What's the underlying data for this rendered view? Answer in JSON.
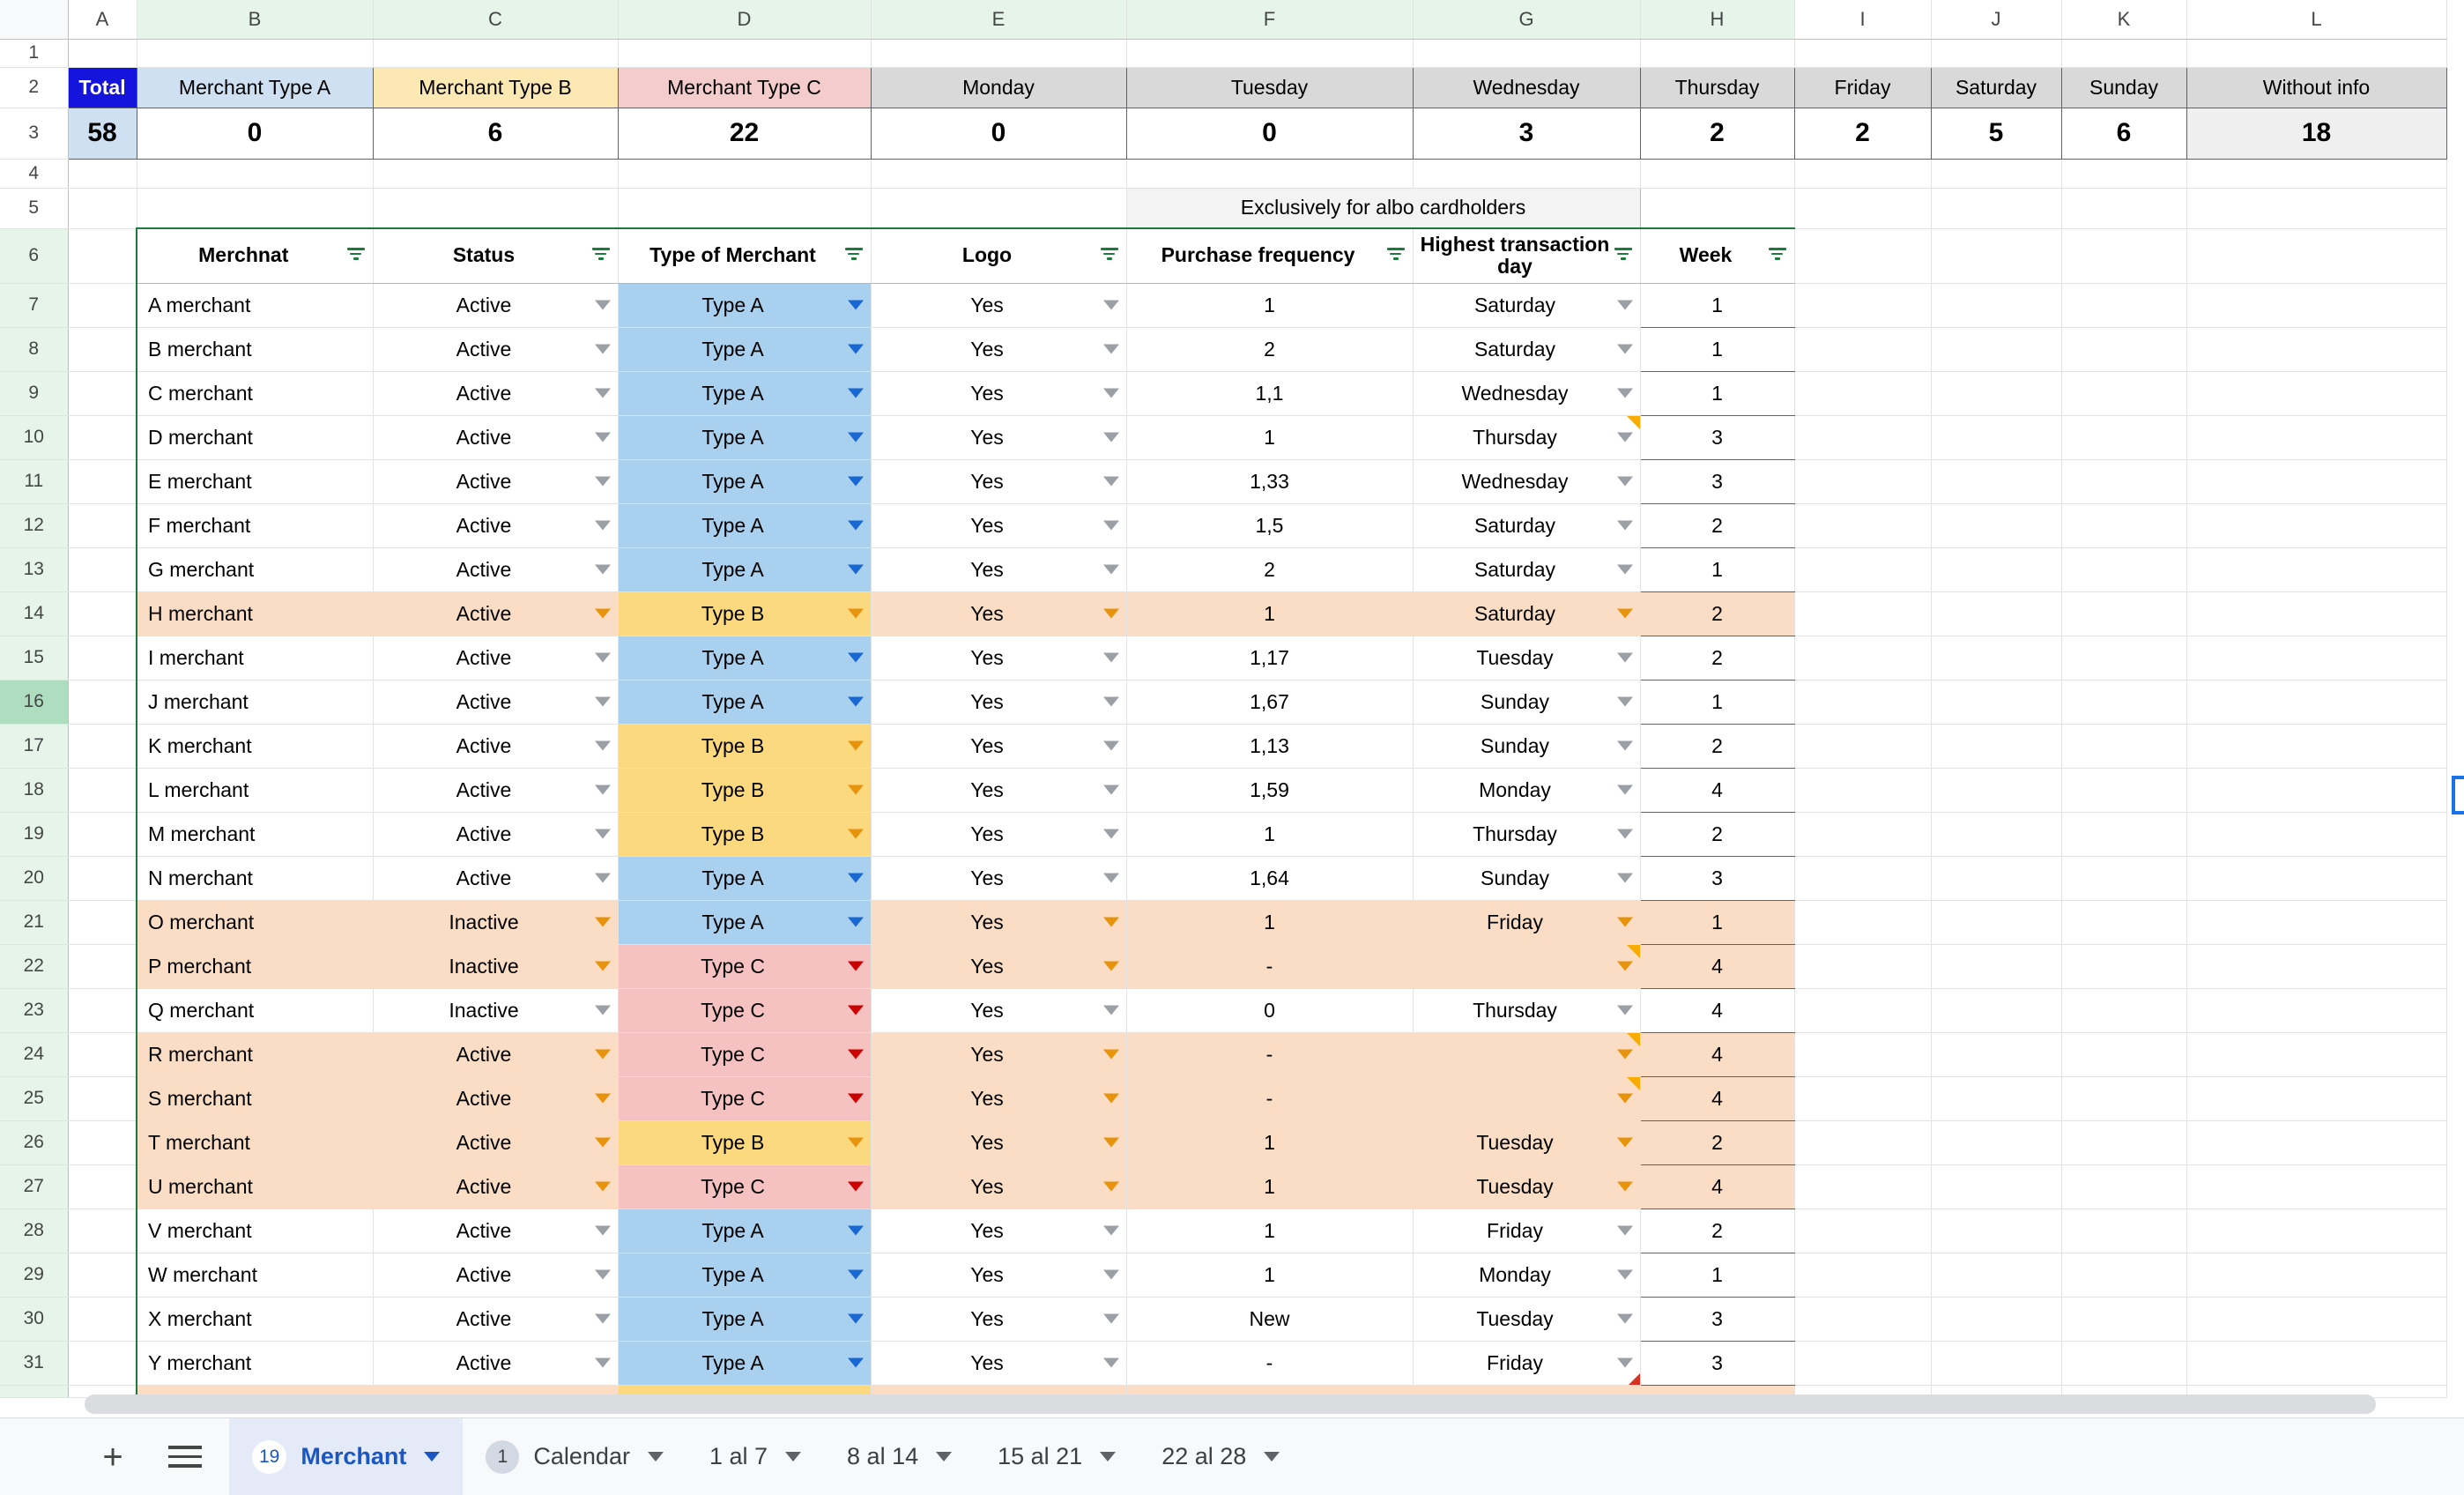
{
  "columns": [
    "A",
    "B",
    "C",
    "D",
    "E",
    "F",
    "G",
    "H",
    "I",
    "J",
    "K",
    "L"
  ],
  "summary": {
    "headers": [
      "Total",
      "Merchant Type A",
      "Merchant Type B",
      "Merchant Type C",
      "Monday",
      "Tuesday",
      "Wednesday",
      "Thursday",
      "Friday",
      "Saturday",
      "Sunday",
      "Without info"
    ],
    "values": [
      "58",
      "0",
      "6",
      "22",
      "0",
      "0",
      "3",
      "2",
      "2",
      "5",
      "6",
      "18"
    ]
  },
  "banner": {
    "text": "Exclusively for albo cardholders"
  },
  "table": {
    "headers": [
      "Merchnat",
      "Status",
      "Type of Merchant",
      "Logo",
      "Purchase frequency",
      "Highest transaction day",
      "Week"
    ],
    "rows": [
      {
        "n": "7",
        "merchant": "A merchant",
        "status": "Active",
        "type": "Type A",
        "logo": "Yes",
        "freq": "1",
        "day": "Saturday",
        "week": "1"
      },
      {
        "n": "8",
        "merchant": "B merchant",
        "status": "Active",
        "type": "Type A",
        "logo": "Yes",
        "freq": "2",
        "day": "Saturday",
        "week": "1"
      },
      {
        "n": "9",
        "merchant": "C merchant",
        "status": "Active",
        "type": "Type A",
        "logo": "Yes",
        "freq": "1,1",
        "day": "Wednesday",
        "week": "1"
      },
      {
        "n": "10",
        "merchant": "D merchant",
        "status": "Active",
        "type": "Type A",
        "logo": "Yes",
        "freq": "1",
        "day": "Thursday",
        "week": "3"
      },
      {
        "n": "11",
        "merchant": "E merchant",
        "status": "Active",
        "type": "Type A",
        "logo": "Yes",
        "freq": "1,33",
        "day": "Wednesday",
        "week": "3"
      },
      {
        "n": "12",
        "merchant": "F merchant",
        "status": "Active",
        "type": "Type A",
        "logo": "Yes",
        "freq": "1,5",
        "day": "Saturday",
        "week": "2"
      },
      {
        "n": "13",
        "merchant": "G merchant",
        "status": "Active",
        "type": "Type A",
        "logo": "Yes",
        "freq": "2",
        "day": "Saturday",
        "week": "1"
      },
      {
        "n": "14",
        "merchant": "H merchant",
        "status": "Active",
        "type": "Type B",
        "logo": "Yes",
        "freq": "1",
        "day": "Saturday",
        "week": "2"
      },
      {
        "n": "15",
        "merchant": "I merchant",
        "status": "Active",
        "type": "Type A",
        "logo": "Yes",
        "freq": "1,17",
        "day": "Tuesday",
        "week": "2"
      },
      {
        "n": "16",
        "merchant": "J merchant",
        "status": "Active",
        "type": "Type A",
        "logo": "Yes",
        "freq": "1,67",
        "day": "Sunday",
        "week": "1"
      },
      {
        "n": "17",
        "merchant": "K merchant",
        "status": "Active",
        "type": "Type B",
        "logo": "Yes",
        "freq": "1,13",
        "day": "Sunday",
        "week": "2"
      },
      {
        "n": "18",
        "merchant": "L merchant",
        "status": "Active",
        "type": "Type B",
        "logo": "Yes",
        "freq": "1,59",
        "day": "Monday",
        "week": "4"
      },
      {
        "n": "19",
        "merchant": "M merchant",
        "status": "Active",
        "type": "Type B",
        "logo": "Yes",
        "freq": "1",
        "day": "Thursday",
        "week": "2"
      },
      {
        "n": "20",
        "merchant": "N merchant",
        "status": "Active",
        "type": "Type A",
        "logo": "Yes",
        "freq": "1,64",
        "day": "Sunday",
        "week": "3"
      },
      {
        "n": "21",
        "merchant": "O merchant",
        "status": "Inactive",
        "type": "Type A",
        "logo": "Yes",
        "freq": "1",
        "day": "Friday",
        "week": "1"
      },
      {
        "n": "22",
        "merchant": "P merchant",
        "status": "Inactive",
        "type": "Type C",
        "logo": "Yes",
        "freq": "-",
        "day": "",
        "week": "4"
      },
      {
        "n": "23",
        "merchant": "Q merchant",
        "status": "Inactive",
        "type": "Type C",
        "logo": "Yes",
        "freq": "0",
        "day": "Thursday",
        "week": "4"
      },
      {
        "n": "24",
        "merchant": "R merchant",
        "status": "Active",
        "type": "Type C",
        "logo": "Yes",
        "freq": "-",
        "day": "",
        "week": "4"
      },
      {
        "n": "25",
        "merchant": "S merchant",
        "status": "Active",
        "type": "Type C",
        "logo": "Yes",
        "freq": "-",
        "day": "",
        "week": "4"
      },
      {
        "n": "26",
        "merchant": "T merchant",
        "status": "Active",
        "type": "Type B",
        "logo": "Yes",
        "freq": "1",
        "day": "Tuesday",
        "week": "2"
      },
      {
        "n": "27",
        "merchant": "U merchant",
        "status": "Active",
        "type": "Type C",
        "logo": "Yes",
        "freq": "1",
        "day": "Tuesday",
        "week": "4"
      },
      {
        "n": "28",
        "merchant": "V merchant",
        "status": "Active",
        "type": "Type A",
        "logo": "Yes",
        "freq": "1",
        "day": "Friday",
        "week": "2"
      },
      {
        "n": "29",
        "merchant": "W merchant",
        "status": "Active",
        "type": "Type A",
        "logo": "Yes",
        "freq": "1",
        "day": "Monday",
        "week": "1"
      },
      {
        "n": "30",
        "merchant": "X merchant",
        "status": "Active",
        "type": "Type A",
        "logo": "Yes",
        "freq": "New",
        "day": "Tuesday",
        "week": "3"
      },
      {
        "n": "31",
        "merchant": "Y merchant",
        "status": "Active",
        "type": "Type A",
        "logo": "Yes",
        "freq": "-",
        "day": "Friday",
        "week": "3"
      }
    ]
  },
  "sheetbar": {
    "add_label": "+",
    "tabs": [
      {
        "badge": "19",
        "label": "Merchant",
        "active": true
      },
      {
        "badge": "1",
        "label": "Calendar",
        "active": false
      },
      {
        "badge": "",
        "label": "1 al 7",
        "active": false
      },
      {
        "badge": "",
        "label": "8 al 14",
        "active": false
      },
      {
        "badge": "",
        "label": "15 al 21",
        "active": false
      },
      {
        "badge": "",
        "label": "22 al 28",
        "active": false
      }
    ]
  },
  "colors": {
    "total_blue": "#1414dc",
    "type_a": "#a9d0ef",
    "type_b": "#fcd97f",
    "type_c": "#f5c1c1",
    "highlight_peach": "#fbdcc4",
    "table_border_green": "#1e7a3c",
    "selection_blue": "#1a73e8"
  }
}
